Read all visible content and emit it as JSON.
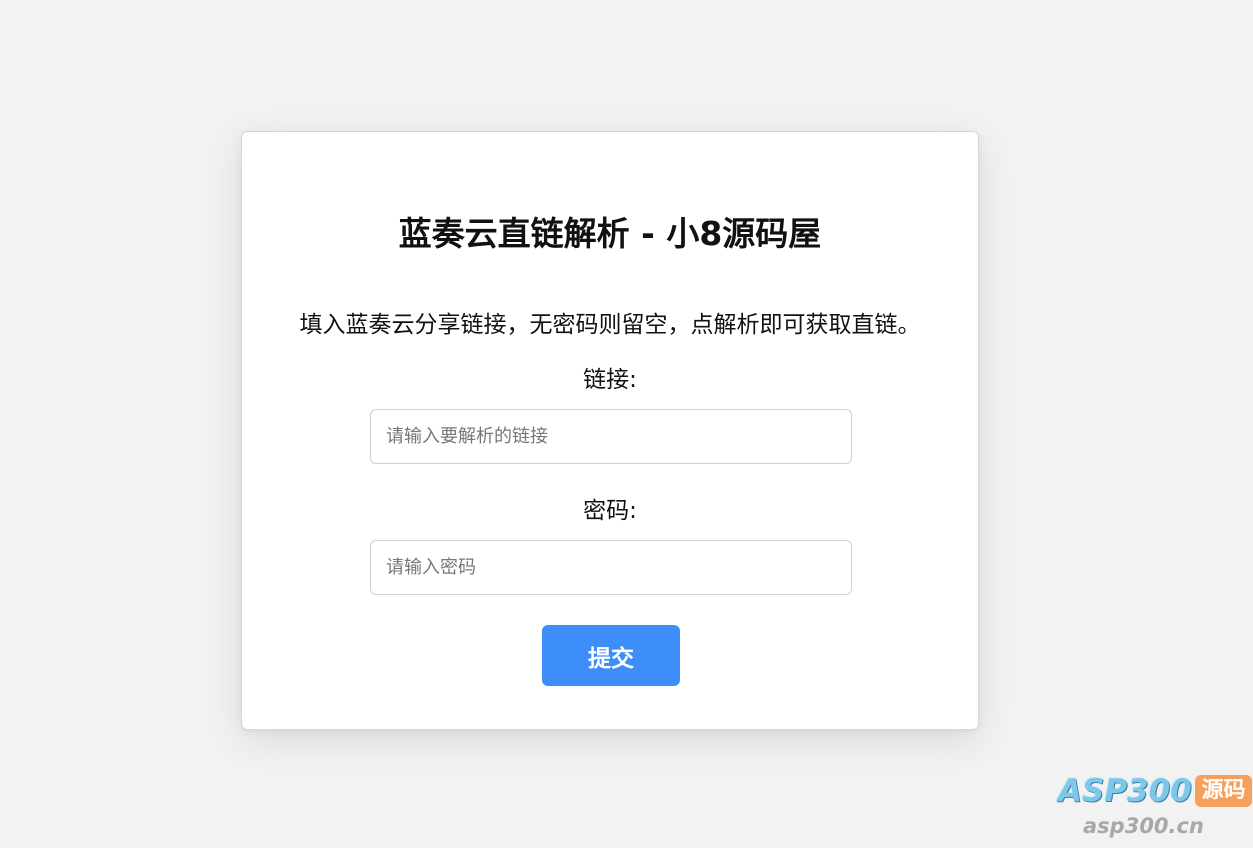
{
  "card": {
    "title": "蓝奏云直链解析 - 小8源码屋",
    "description": "填入蓝奏云分享链接，无密码则留空，点解析即可获取直链。",
    "link_label": "链接:",
    "link_placeholder": "请输入要解析的链接",
    "link_value": "",
    "password_label": "密码:",
    "password_placeholder": "请输入密码",
    "password_value": "",
    "submit_label": "提交"
  },
  "watermark": {
    "brand": "ASP300",
    "badge": "源码",
    "url": "asp300.cn"
  },
  "colors": {
    "background": "#f2f2f2",
    "card": "#ffffff",
    "submit_button": "#3d8ef8",
    "watermark_badge": "#f7a05c",
    "watermark_brand": "#7fc7e8"
  }
}
